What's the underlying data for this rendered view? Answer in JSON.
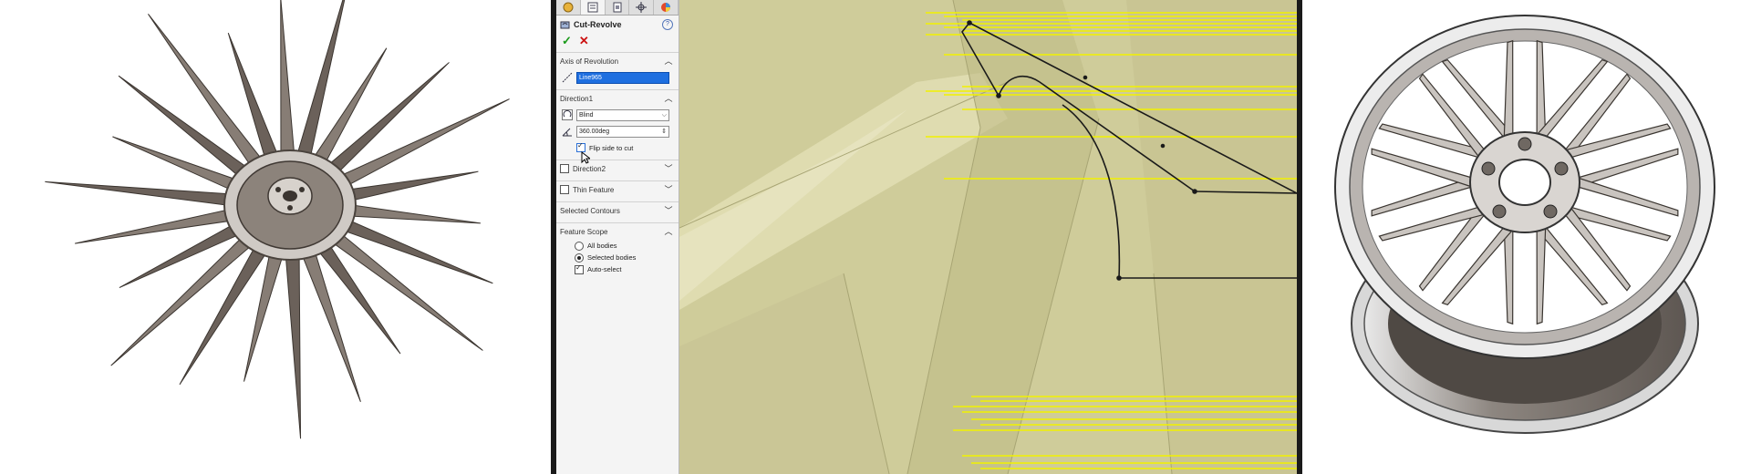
{
  "panel": {
    "title": "Cut-Revolve",
    "help": "?",
    "ok": "✓",
    "cancel": "✕",
    "axis": {
      "header": "Axis of Revolution",
      "value": "Line965"
    },
    "direction1": {
      "header": "Direction1",
      "type": "Blind",
      "angle": "360.00deg",
      "flip_label": "Flip side to cut"
    },
    "direction2": {
      "header": "Direction2"
    },
    "thin": {
      "header": "Thin Feature"
    },
    "contours": {
      "header": "Selected Contours"
    },
    "scope": {
      "header": "Feature Scope",
      "all_bodies": "All bodies",
      "selected_bodies": "Selected bodies",
      "auto_select": "Auto-select"
    }
  },
  "colors": {
    "viewport": "#cfcc9a",
    "accent_selection": "#1e6fe0",
    "sketch_highlight": "#f2f200",
    "metal": "#8a8078"
  },
  "icons": [
    "feature-manager-icon",
    "property-manager-icon",
    "configuration-icon",
    "dimxpert-icon",
    "display-icon"
  ]
}
